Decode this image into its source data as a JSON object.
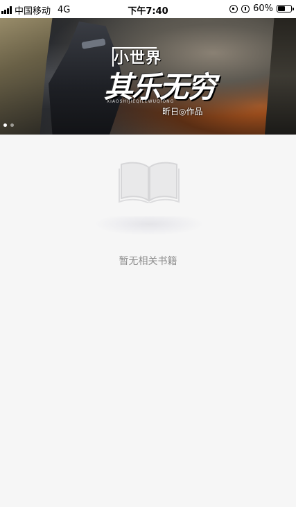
{
  "status_bar": {
    "carrier": "中国移动",
    "network": "4G",
    "time": "下午7:40",
    "battery_text": "60%",
    "battery_level": 0.6
  },
  "banner": {
    "title_small": "小世界",
    "title_big": "其乐无穷",
    "pinyin": "XIAOSHIJIEQILEWUQIONG",
    "author": "昕日◎作品",
    "active_slide": 1,
    "slide_count": 2
  },
  "empty_state": {
    "icon": "book-icon",
    "message": "暂无相关书籍"
  },
  "colors": {
    "background": "#f6f6f6",
    "empty_text": "#8e8e8e"
  }
}
